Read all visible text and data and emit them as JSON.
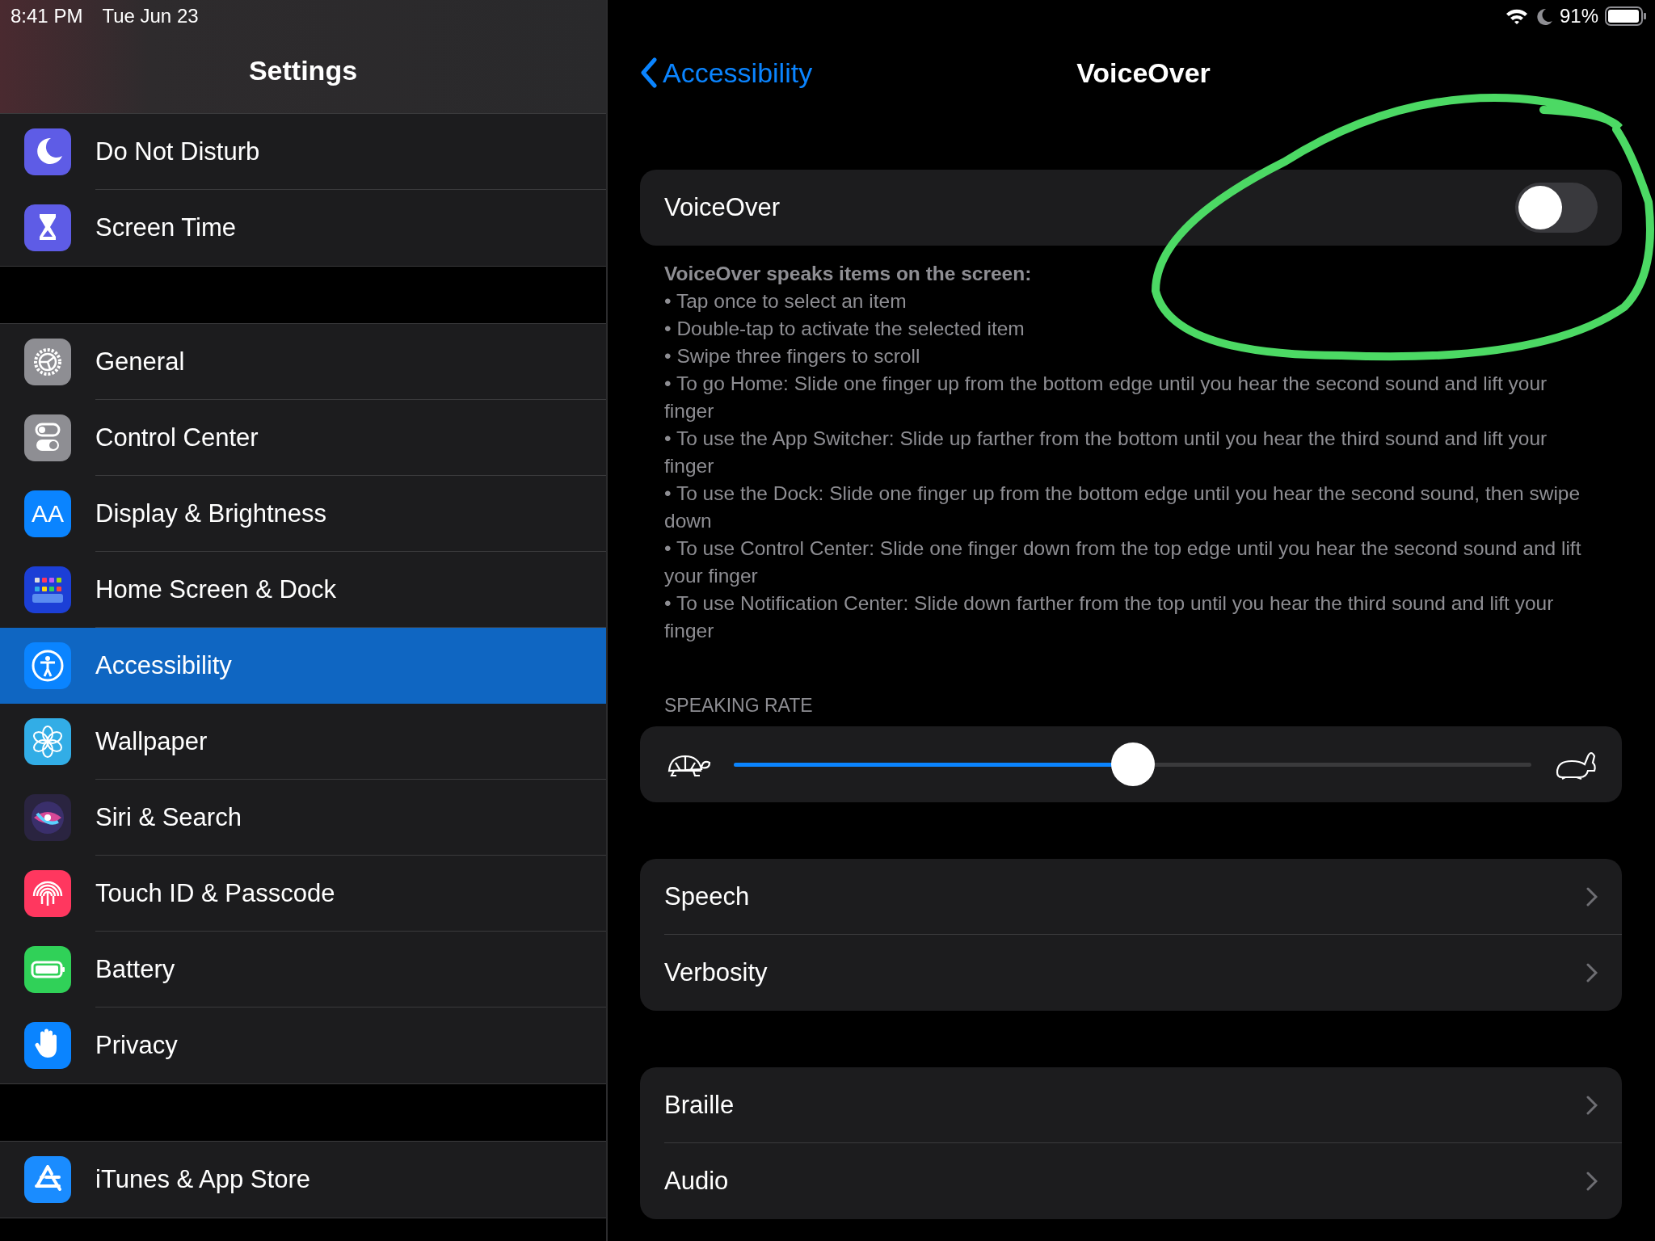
{
  "status_bar": {
    "time": "8:41 PM",
    "date": "Tue Jun 23",
    "battery": "91%"
  },
  "sidebar": {
    "title": "Settings",
    "groups": [
      [
        {
          "label": "Do Not Disturb",
          "selected": false
        },
        {
          "label": "Screen Time",
          "selected": false
        }
      ],
      [
        {
          "label": "General",
          "selected": false
        },
        {
          "label": "Control Center",
          "selected": false
        },
        {
          "label": "Display & Brightness",
          "icon_text": "AA",
          "selected": false
        },
        {
          "label": "Home Screen & Dock",
          "selected": false
        },
        {
          "label": "Accessibility",
          "selected": true
        },
        {
          "label": "Wallpaper",
          "selected": false
        },
        {
          "label": "Siri & Search",
          "selected": false
        },
        {
          "label": "Touch ID & Passcode",
          "selected": false
        },
        {
          "label": "Battery",
          "selected": false
        },
        {
          "label": "Privacy",
          "selected": false
        }
      ],
      [
        {
          "label": "iTunes & App Store",
          "selected": false
        }
      ]
    ]
  },
  "detail": {
    "back": "Accessibility",
    "title": "VoiceOver",
    "voiceover_toggle": {
      "label": "VoiceOver",
      "on": false
    },
    "description": {
      "heading": "VoiceOver speaks items on the screen:",
      "items": [
        "• Tap once to select an item",
        "• Double-tap to activate the selected item",
        "• Swipe three fingers to scroll",
        "• To go Home: Slide one finger up from the bottom edge until you hear the second sound and lift your finger",
        "• To use the App Switcher: Slide up farther from the bottom until you hear the third sound and lift your finger",
        "• To use the Dock: Slide one finger up from the bottom edge until you hear the second sound, then swipe down",
        "• To use Control Center: Slide one finger down from the top edge until you hear the second sound and lift your finger",
        "• To use Notification Center: Slide down farther from the top until you hear the third sound and lift your finger"
      ]
    },
    "speaking_rate": {
      "label": "SPEAKING RATE",
      "level": 0.5
    },
    "groups": [
      [
        "Speech",
        "Verbosity"
      ],
      [
        "Braille",
        "Audio"
      ]
    ]
  }
}
